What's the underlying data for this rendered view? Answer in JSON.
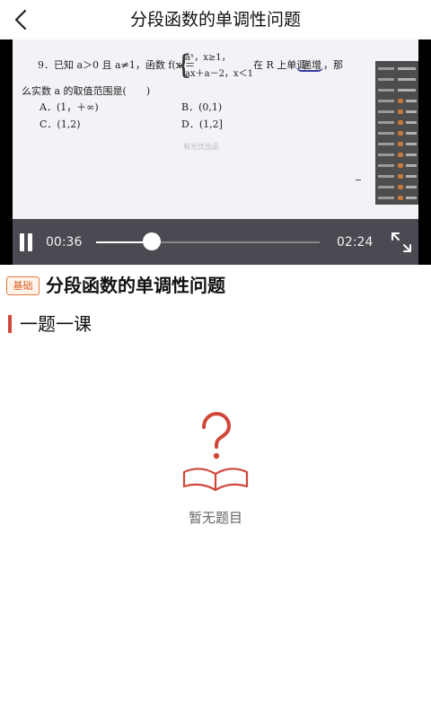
{
  "header": {
    "title": "分段函数的单调性问题",
    "back_icon": "chevron-left-icon"
  },
  "video": {
    "current_time": "00:36",
    "duration": "02:24",
    "progress_fraction": 0.25,
    "state": "playing",
    "slide": {
      "line1_prefix": "9．已知 a＞0 且 a≠1，函数 f(x)＝",
      "piece1": "aˣ，x≥1，",
      "piece2": "ax＋a－2，x＜1",
      "line1_suffix_a": "在 R 上单调",
      "line1_suffix_underlined": "递增",
      "line1_suffix_b": "，那",
      "line2": "么实数 a 的取值范围是(　　)",
      "option_a": "A．(1，＋∞)",
      "option_b": "B．(0,1)",
      "option_c": "C．(1,2)",
      "option_d": "D．(1,2]",
      "watermark": "有光优出品"
    }
  },
  "lesson": {
    "level_badge": "基础",
    "title": "分段函数的单调性问题"
  },
  "section": {
    "title": "一题一课"
  },
  "empty_state": {
    "icon": "question-book-icon",
    "text": "暂无题目"
  },
  "colors": {
    "accent_red": "#d0473a",
    "badge_orange": "#e5793f",
    "video_bg": "#000000",
    "slide_bg": "#f3f3f7"
  }
}
